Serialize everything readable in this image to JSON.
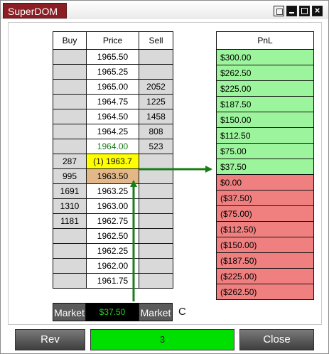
{
  "window": {
    "title": "SuperDOM"
  },
  "ladder": {
    "headers": {
      "buy": "Buy",
      "price": "Price",
      "sell": "Sell"
    },
    "rows": [
      {
        "buy": "",
        "price": "1965.50",
        "sell": ""
      },
      {
        "buy": "",
        "price": "1965.25",
        "sell": ""
      },
      {
        "buy": "",
        "price": "1965.00",
        "sell": "2052"
      },
      {
        "buy": "",
        "price": "1964.75",
        "sell": "1225"
      },
      {
        "buy": "",
        "price": "1964.50",
        "sell": "1458"
      },
      {
        "buy": "",
        "price": "1964.25",
        "sell": "808"
      },
      {
        "buy": "",
        "price": "1964.00",
        "sell": "523"
      },
      {
        "buy": "287",
        "price": "(1) 1963.7",
        "sell": ""
      },
      {
        "buy": "995",
        "price": "1963.50",
        "sell": ""
      },
      {
        "buy": "1691",
        "price": "1963.25",
        "sell": ""
      },
      {
        "buy": "1310",
        "price": "1963.00",
        "sell": ""
      },
      {
        "buy": "1181",
        "price": "1962.75",
        "sell": ""
      },
      {
        "buy": "",
        "price": "1962.50",
        "sell": ""
      },
      {
        "buy": "",
        "price": "1962.25",
        "sell": ""
      },
      {
        "buy": "",
        "price": "1962.00",
        "sell": ""
      },
      {
        "buy": "",
        "price": "1961.75",
        "sell": ""
      }
    ],
    "buy_market_label": "Market",
    "sell_market_label": "Market",
    "pnl_display": "$37.50",
    "c_label": "C"
  },
  "pnl": {
    "header": "PnL",
    "rows": [
      {
        "value": "$300.00",
        "sign": "pos"
      },
      {
        "value": "$262.50",
        "sign": "pos"
      },
      {
        "value": "$225.00",
        "sign": "pos"
      },
      {
        "value": "$187.50",
        "sign": "pos"
      },
      {
        "value": "$150.00",
        "sign": "pos"
      },
      {
        "value": "$112.50",
        "sign": "pos"
      },
      {
        "value": "$75.00",
        "sign": "pos"
      },
      {
        "value": "$37.50",
        "sign": "pos"
      },
      {
        "value": "$0.00",
        "sign": "neg"
      },
      {
        "value": "($37.50)",
        "sign": "neg"
      },
      {
        "value": "($75.00)",
        "sign": "neg"
      },
      {
        "value": "($112.50)",
        "sign": "neg"
      },
      {
        "value": "($150.00)",
        "sign": "neg"
      },
      {
        "value": "($187.50)",
        "sign": "neg"
      },
      {
        "value": "($225.00)",
        "sign": "neg"
      },
      {
        "value": "($262.50)",
        "sign": "neg"
      }
    ]
  },
  "footer": {
    "rev_label": "Rev",
    "quantity": "3",
    "close_label": "Close"
  },
  "colors": {
    "title_tab": "#8b1d24",
    "profit": "#9cf59c",
    "loss": "#f08080",
    "quantity": "#00e000",
    "current_price": "#ffff00",
    "entry_price": "#e3b889",
    "last_price_text": "#1a7d1a",
    "arrow": "#1a7d1a"
  }
}
